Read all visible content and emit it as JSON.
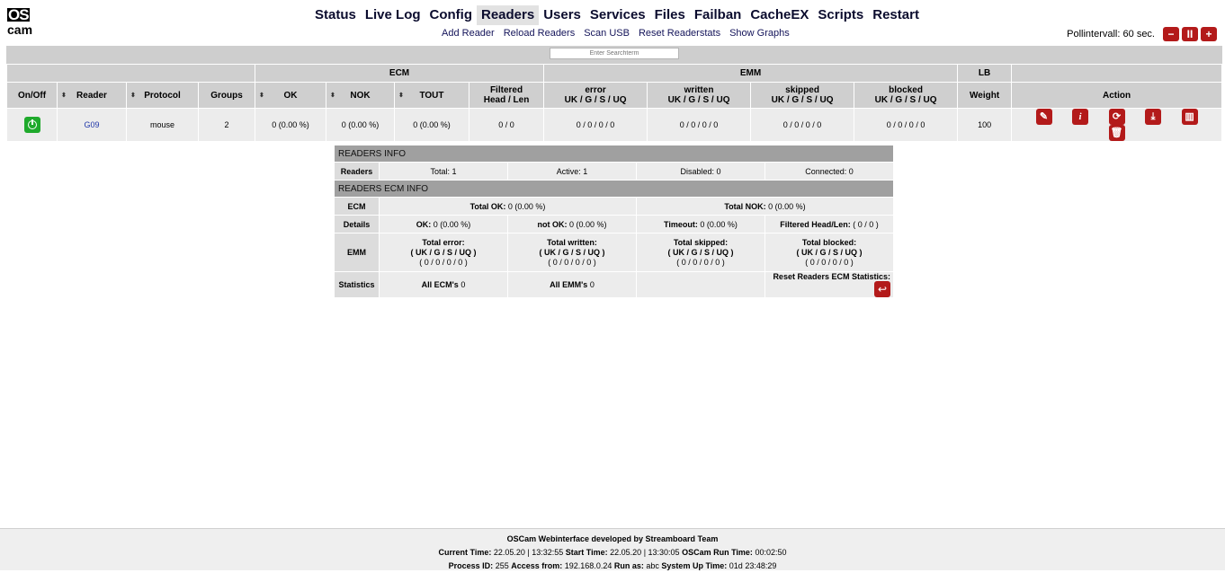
{
  "logo": {
    "line1": "OS",
    "line2": "cam"
  },
  "nav": {
    "items": [
      "Status",
      "Live Log",
      "Config",
      "Readers",
      "Users",
      "Services",
      "Files",
      "Failban",
      "CacheEX",
      "Scripts",
      "Restart"
    ],
    "active": "Readers"
  },
  "subnav": [
    "Add Reader",
    "Reload Readers",
    "Scan USB",
    "Reset Readerstats",
    "Show Graphs"
  ],
  "poll": {
    "label": "Pollintervall:",
    "value": "60",
    "unit": "sec.",
    "buttons": [
      "−",
      "II",
      "+"
    ]
  },
  "search": {
    "placeholder": "Enter Searchterm"
  },
  "readers_table": {
    "groups": {
      "ecm": "ECM",
      "emm": "EMM",
      "lb": "LB"
    },
    "headers": {
      "onoff": "On/Off",
      "reader": "Reader",
      "protocol": "Protocol",
      "groups": "Groups",
      "ok": "OK",
      "nok": "NOK",
      "tout": "TOUT",
      "filtered1": "Filtered",
      "filtered2": "Head / Len",
      "error": "error",
      "written": "written",
      "skipped": "skipped",
      "blocked": "blocked",
      "emm_sub": "UK / G / S / UQ",
      "weight": "Weight",
      "action": "Action",
      "sort_glyph": "⬍"
    },
    "row": {
      "reader": "G09",
      "protocol": "mouse",
      "groups": "2",
      "ok": "0 (0.00 %)",
      "nok": "0 (0.00 %)",
      "tout": "0 (0.00 %)",
      "filtered": "0 / 0",
      "error": "0 / 0 / 0 / 0",
      "written": "0 / 0 / 0 / 0",
      "skipped": "0 / 0 / 0 / 0",
      "blocked": "0 / 0 / 0 / 0",
      "weight": "100"
    },
    "action_glyphs": {
      "edit": "✎",
      "info": "i",
      "refresh": "⟳",
      "download": "⤓",
      "stats": "▥",
      "delete": "🗑"
    }
  },
  "info": {
    "readers_info": "READERS INFO",
    "readers_label": "Readers",
    "total": "Total: 1",
    "active": "Active: 1",
    "disabled": "Disabled: 0",
    "connected": "Connected: 0",
    "ecm_info": "READERS ECM INFO",
    "ecm_label": "ECM",
    "total_ok_label": "Total OK:",
    "total_ok_value": "0 (0.00 %)",
    "total_nok_label": "Total NOK:",
    "total_nok_value": "0 (0.00 %)",
    "details_label": "Details",
    "ok_label": "OK:",
    "ok_value": "0 (0.00 %)",
    "notok_label": "not OK:",
    "notok_value": "0 (0.00 %)",
    "timeout_label": "Timeout:",
    "timeout_value": "0 (0.00 %)",
    "filtered_label": "Filtered Head/Len:",
    "filtered_value": "( 0 / 0 )",
    "emm_label": "EMM",
    "total_error": "Total error:",
    "total_written": "Total written:",
    "total_skipped": "Total skipped:",
    "total_blocked": "Total blocked:",
    "emm_sub": "( UK / G / S / UQ )",
    "emm_vals": "( 0 / 0 / 0 / 0 )",
    "statistics_label": "Statistics",
    "all_ecms_label": "All ECM's",
    "all_ecms_value": "0",
    "all_emms_label": "All EMM's",
    "all_emms_value": "0",
    "reset_label": "Reset Readers ECM Statistics:",
    "reset_glyph": "↩"
  },
  "footer": {
    "line1": "OSCam Webinterface developed by Streamboard Team",
    "current_label": "Current Time:",
    "current_value": "22.05.20 | 13:32:55",
    "start_label": "Start Time:",
    "start_value": "22.05.20 | 13:30:05",
    "run_label": "OSCam Run Time:",
    "run_value": "00:02:50",
    "pid_label": "Process ID:",
    "pid_value": "255",
    "access_label": "Access from:",
    "access_value": "192.168.0.24",
    "runas_label": "Run as:",
    "runas_value": "abc",
    "uptime_label": "System Up Time:",
    "uptime_value": "01d 23:48:29"
  }
}
